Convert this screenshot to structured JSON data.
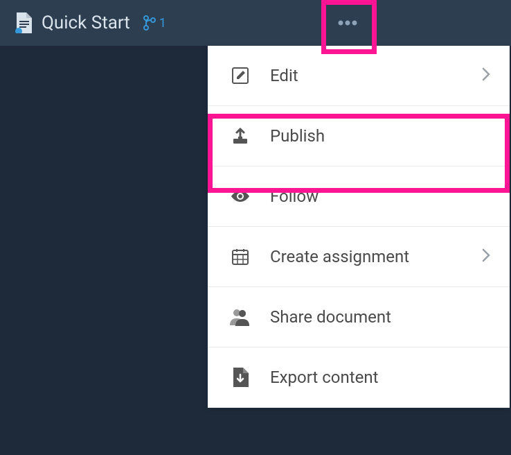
{
  "header": {
    "title": "Quick Start",
    "branch_count": "1"
  },
  "menu": {
    "edit": "Edit",
    "publish": "Publish",
    "follow": "Follow",
    "create_assignment": "Create assignment",
    "share_document": "Share document",
    "export_content": "Export content"
  }
}
